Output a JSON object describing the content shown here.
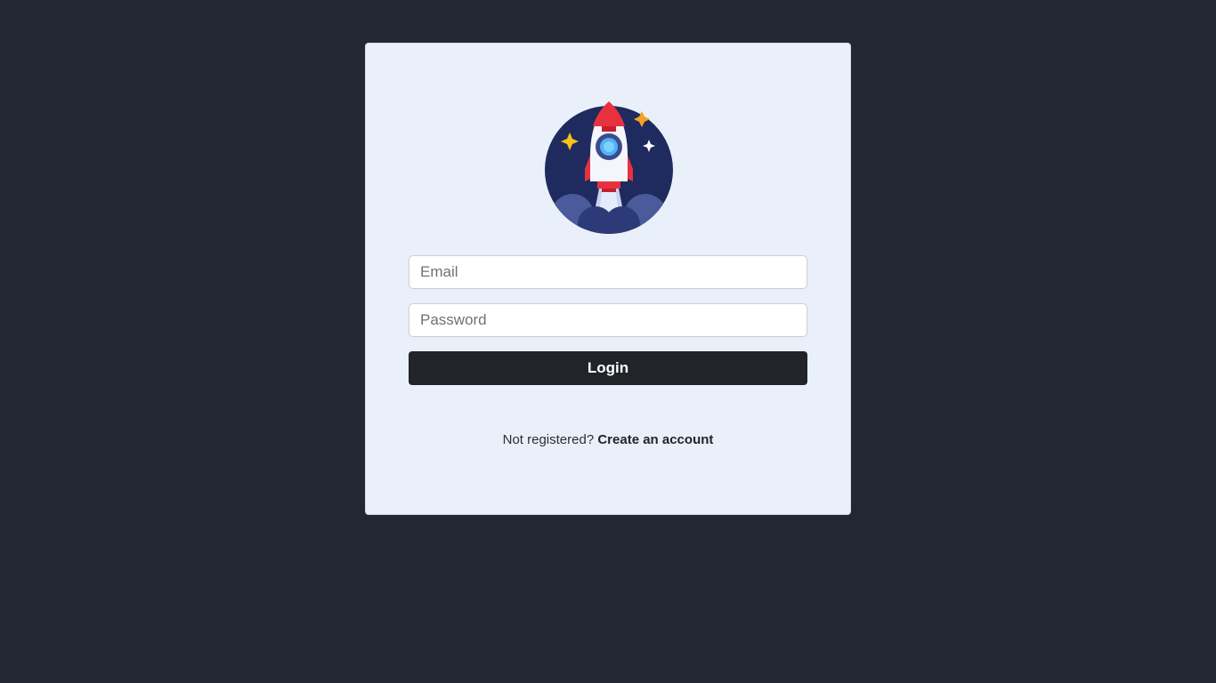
{
  "form": {
    "email_placeholder": "Email",
    "password_placeholder": "Password",
    "login_label": "Login"
  },
  "footer": {
    "prompt_text": "Not registered?",
    "link_text": "Create an account"
  },
  "logo": {
    "icon": "rocket-launch-icon"
  },
  "colors": {
    "page_background": "#222731",
    "card_background": "#eaf0f9",
    "button_background": "#212529",
    "button_text": "#ffffff",
    "logo_circle": "#1f2a5e",
    "rocket_red": "#e8313f",
    "star_yellow": "#f7c21b",
    "star_orange": "#f5a023"
  }
}
